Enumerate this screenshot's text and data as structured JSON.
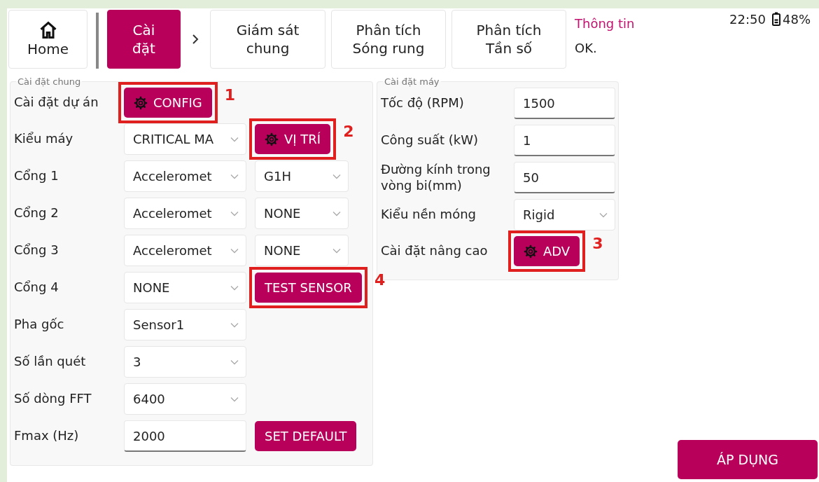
{
  "nav": {
    "home": {
      "label": "Home"
    },
    "tabs": [
      {
        "label": "Cài đặt",
        "selected": true
      },
      {
        "label": "Giám sát chung",
        "selected": false
      },
      {
        "label": "Phân tích Sóng rung",
        "selected": false
      },
      {
        "label": "Phân tích Tần số",
        "selected": false
      }
    ],
    "info": {
      "title": "Thông tin",
      "message": "OK."
    },
    "status": {
      "time": "22:50",
      "battery": "48%"
    }
  },
  "general": {
    "title": "Cài đặt chung",
    "rows": [
      {
        "label": "Cài đặt dự án",
        "controls": [
          {
            "kind": "gear_button",
            "text": "CONFIG",
            "callout": "1"
          }
        ]
      },
      {
        "label": "Kiểu máy",
        "controls": [
          {
            "kind": "select",
            "value": "CRITICAL MA"
          },
          {
            "kind": "gear_button",
            "text": "VỊ TRÍ",
            "callout": "2"
          }
        ]
      },
      {
        "label": "Cổng 1",
        "controls": [
          {
            "kind": "select",
            "value": "Acceleromet"
          },
          {
            "kind": "select",
            "value": "G1H"
          }
        ]
      },
      {
        "label": "Cổng 2",
        "controls": [
          {
            "kind": "select",
            "value": "Acceleromet"
          },
          {
            "kind": "select",
            "value": "NONE"
          }
        ]
      },
      {
        "label": "Cổng 3",
        "controls": [
          {
            "kind": "select",
            "value": "Acceleromet"
          },
          {
            "kind": "select",
            "value": "NONE"
          }
        ]
      },
      {
        "label": "Cổng 4",
        "controls": [
          {
            "kind": "select",
            "value": "NONE"
          },
          {
            "kind": "button",
            "text": "TEST SENSOR",
            "callout": "4"
          }
        ]
      },
      {
        "label": "Pha gốc",
        "controls": [
          {
            "kind": "select",
            "value": "Sensor1"
          }
        ]
      },
      {
        "label": "Số lần quét",
        "controls": [
          {
            "kind": "select",
            "value": "3"
          }
        ]
      },
      {
        "label": "Số dòng FFT",
        "controls": [
          {
            "kind": "select",
            "value": "6400"
          }
        ]
      },
      {
        "label": "Fmax (Hz)",
        "controls": [
          {
            "kind": "input",
            "value": "2000"
          },
          {
            "kind": "button",
            "text": "SET DEFAULT"
          }
        ]
      }
    ]
  },
  "machine": {
    "title": "Cài đặt máy",
    "rows": [
      {
        "label": "Tốc độ (RPM)",
        "controls": [
          {
            "kind": "input",
            "value": "1500"
          }
        ]
      },
      {
        "label": "Công suất (kW)",
        "controls": [
          {
            "kind": "input",
            "value": "1"
          }
        ]
      },
      {
        "label": "Đường kính trong vòng bi(mm)",
        "controls": [
          {
            "kind": "input",
            "value": "50"
          }
        ]
      },
      {
        "label": "Kiểu nền móng",
        "controls": [
          {
            "kind": "select",
            "value": "Rigid"
          }
        ]
      },
      {
        "label": "Cài đặt nâng cao",
        "controls": [
          {
            "kind": "gear_button",
            "text": "ADV",
            "callout": "3"
          }
        ]
      }
    ]
  },
  "apply_button": {
    "text": "ÁP DỤNG"
  }
}
